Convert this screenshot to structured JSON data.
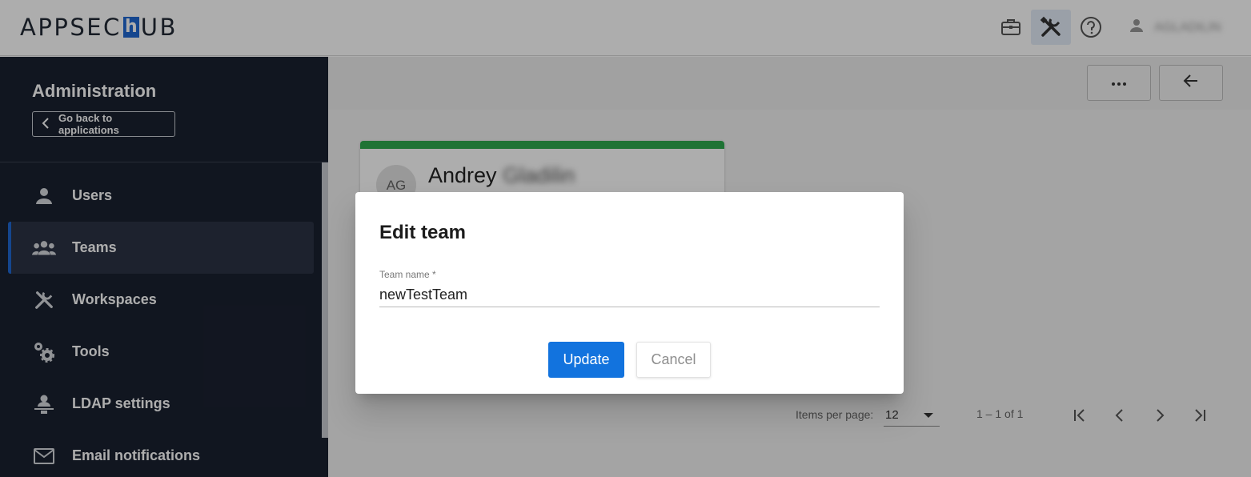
{
  "header": {
    "logo_left": "APPSEC",
    "logo_h": "h",
    "logo_right": "UB",
    "icons": [
      "briefcase-icon",
      "tools-icon",
      "help-icon",
      "user-icon"
    ],
    "user_name": "AGLADILIN"
  },
  "sidebar": {
    "title": "Administration",
    "back_label": "Go back to applications",
    "items": [
      {
        "label": "Users",
        "icon": "user-icon"
      },
      {
        "label": "Teams",
        "icon": "group-icon",
        "active": true
      },
      {
        "label": "Workspaces",
        "icon": "tools-icon"
      },
      {
        "label": "Tools",
        "icon": "gears-icon"
      },
      {
        "label": "LDAP settings",
        "icon": "ldap-icon"
      },
      {
        "label": "Email notifications",
        "icon": "mail-icon"
      }
    ]
  },
  "toolbar": {
    "more_icon": "more-horizontal-icon",
    "back_icon": "arrow-left-icon"
  },
  "card": {
    "initials": "AG",
    "first_name": "Andrey",
    "last_name": "Gladilin",
    "accent": "#2eaa4f"
  },
  "pagination": {
    "items_label": "Items per page:",
    "page_size": "12",
    "range": "1 – 1 of 1"
  },
  "dialog": {
    "title": "Edit team",
    "field_label": "Team name *",
    "field_value": "newTestTeam",
    "update_label": "Update",
    "cancel_label": "Cancel"
  },
  "colors": {
    "primary": "#1273de",
    "sidebar_bg": "#1a2130",
    "sidebar_active": "#2c3344"
  }
}
